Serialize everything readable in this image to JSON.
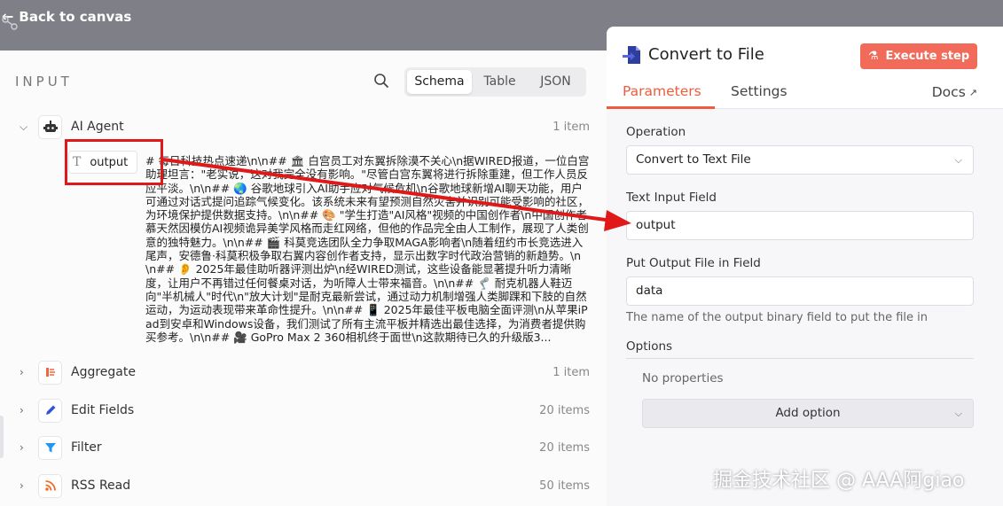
{
  "topbar": {
    "back_label": "Back to canvas"
  },
  "input_panel": {
    "title": "INPUT",
    "view_tabs": [
      "Schema",
      "Table",
      "JSON"
    ],
    "nodes": [
      {
        "name": "AI Agent",
        "count": "1 item",
        "icon": "robot-icon",
        "color": "#333333"
      },
      {
        "name": "Aggregate",
        "count": "1 item",
        "icon": "aggregate-icon",
        "color": "#f2663b"
      },
      {
        "name": "Edit Fields",
        "count": "20 items",
        "icon": "pencil-icon",
        "color": "#2f54d9"
      },
      {
        "name": "Filter",
        "count": "20 items",
        "icon": "filter-icon",
        "color": "#2196f3"
      },
      {
        "name": "RSS Read",
        "count": "50 items",
        "icon": "rss-icon",
        "color": "#f26b2a"
      }
    ],
    "field": {
      "name": "output",
      "value": "# 每日科技热点速递\\n\\n## 🏛 白宫员工对东翼拆除漠不关心\\n据WIRED报道，一位白宫助理坦言：\"老实说，这对我完全没有影响。\"尽管白宫东翼将进行拆除重建，但工作人员反应平淡。\\n\\n## 🌏 谷歌地球引入AI助手应对气候危机\\n谷歌地球新增AI聊天功能，用户可通过对话式提问追踪气候变化。该系统未来有望预测自然灾害并识别可能受影响的社区，为环境保护提供数据支持。\\n\\n## 🎨 \"学生打造\"AI风格\"视频的中国创作者\\n中国创作者慕天然因模仿AI视频诡异美学风格而走红网络，但他的作品完全由人工制作，展现了人类创意的独特魅力。\\n\\n## 🎬 科莫竞选团队全力争取MAGA影响者\\n随着纽约市长竞选进入尾声，安德鲁·科莫积极争取右翼内容创作者支持，显示出数字时代政治营销的新趋势。\\n\\n## 👂 2025年最佳助听器评测出炉\\n经WIRED测试，这些设备能显著提升听力清晰度，让用户不再错过任何餐桌对话，为听障人士带来福音。\\n\\n## 🦿 耐克机器人鞋迈向\"半机械人\"时代\\n\"放大计划\"是耐克最新尝试，通过动力机制增强人类脚踝和下肢的自然运动，为运动表现带来革命性提升。\\n\\n## 📱 2025年最佳平板电脑全面评测\\n从苹果iPad到安卓和Windows设备，我们测试了所有主流平板并精选出最佳选择，为消费者提供购买参考。\\n\\n## 🎥 GoPro Max 2 360相机终于面世\\n这款期待已久的升级版3..."
    }
  },
  "param_panel": {
    "title": "Convert to File",
    "execute_label": "Execute step",
    "tabs": {
      "parameters": "Parameters",
      "settings": "Settings",
      "docs": "Docs"
    },
    "operation": {
      "label": "Operation",
      "value": "Convert to Text File"
    },
    "text_input": {
      "label": "Text Input Field",
      "value": "output"
    },
    "output_field": {
      "label": "Put Output File in Field",
      "value": "data",
      "hint": "The name of the output binary field to put the file in"
    },
    "options": {
      "label": "Options",
      "empty": "No properties",
      "add_label": "Add option"
    }
  },
  "watermark": "掘金技术社区 @ AAA阿giao",
  "colors": {
    "accent": "#ef5c3d",
    "execute": "#f26b5a",
    "annotation": "#e01818"
  }
}
